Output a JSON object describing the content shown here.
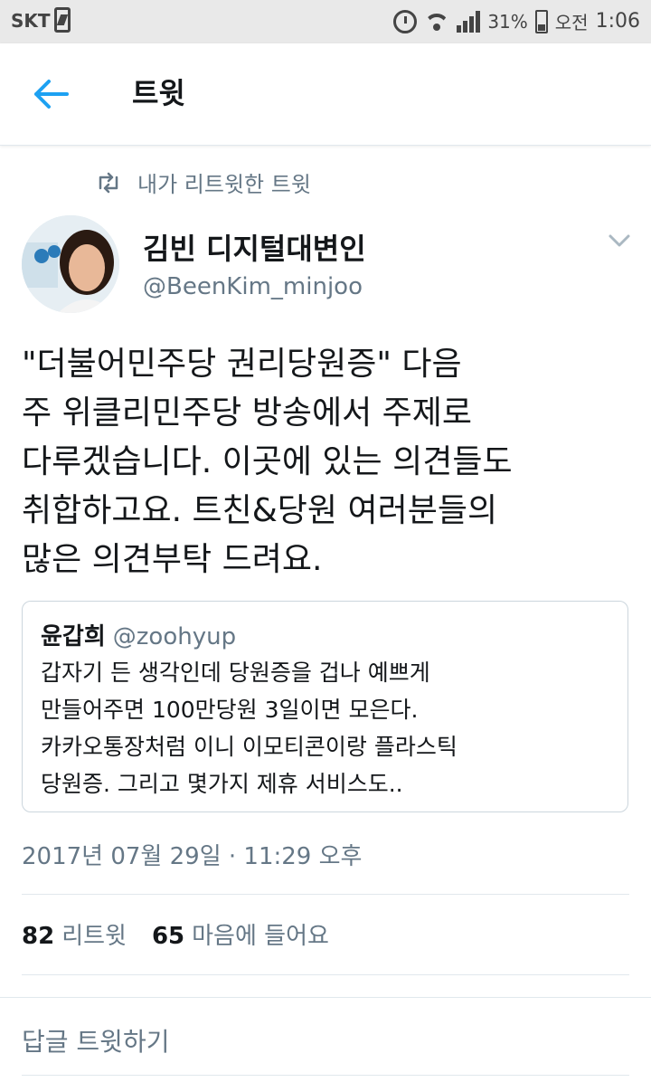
{
  "status_bar": {
    "carrier": "SKT",
    "battery": "31%",
    "ampm": "오전",
    "time": "1:06"
  },
  "app_bar": {
    "title": "트윗"
  },
  "retweet_context": {
    "label": "내가 리트윗한 트윗"
  },
  "tweet": {
    "author_name": "김빈 디지털대변인",
    "author_handle": "@BeenKim_minjoo",
    "text": "\"더불어민주당 권리당원증\" 다음\n주 위클리민주당 방송에서 주제로\n다루겠습니다. 이곳에 있는 의견들도\n취합하고요. 트친&당원 여러분들의\n많은 의견부탁 드려요.",
    "timestamp": "2017년 07월 29일 · 11:29 오후",
    "retweet_count": "82",
    "retweet_label": "리트윗",
    "like_count": "65",
    "like_label": "마음에 들어요"
  },
  "quoted_tweet": {
    "author_name": "윤갑희",
    "author_handle": "@zoohyup",
    "text": "갑자기 든 생각인데 당원증을 겁나 예쁘게\n만들어주면 100만당원 3일이면 모은다.\n카카오통장처럼 이니 이모티콘이랑 플라스틱\n당원증. 그리고 몇가지 제휴 서비스도.."
  },
  "reply_box": {
    "placeholder": "답글 트윗하기"
  },
  "colors": {
    "accent": "#1da1f2",
    "secondary_text": "#657786",
    "primary_text": "#14171a",
    "border": "#e1e8ed"
  },
  "icons": {
    "back": "arrow-left-icon",
    "retweet": "retweet-icon",
    "more": "chevron-down-icon"
  }
}
